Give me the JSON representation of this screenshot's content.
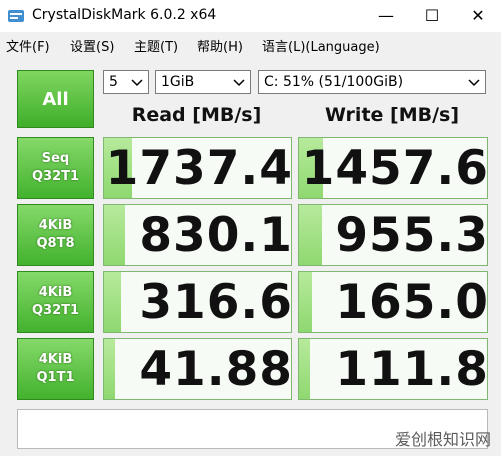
{
  "window": {
    "title": "CrystalDiskMark 6.0.2 x64",
    "minimize": "—",
    "maximize": "☐",
    "close": "✕"
  },
  "menu": [
    "文件(F)",
    "设置(S)",
    "主题(T)",
    "帮助(H)",
    "语言(L)(Language)"
  ],
  "controls": {
    "all_label": "All",
    "count": "5",
    "size": "1GiB",
    "drive": "C: 51% (51/100GiB)"
  },
  "headers": {
    "read": "Read [MB/s]",
    "write": "Write [MB/s]"
  },
  "rows": [
    {
      "label1": "Seq",
      "label2": "Q32T1",
      "read": "1737.4",
      "write": "1457.6",
      "read_fill": 0.15,
      "write_fill": 0.13
    },
    {
      "label1": "4KiB",
      "label2": "Q8T8",
      "read": "830.1",
      "write": "955.3",
      "read_fill": 0.11,
      "write_fill": 0.12
    },
    {
      "label1": "4KiB",
      "label2": "Q32T1",
      "read": "316.6",
      "write": "165.0",
      "read_fill": 0.09,
      "write_fill": 0.07
    },
    {
      "label1": "4KiB",
      "label2": "Q1T1",
      "read": "41.88",
      "write": "111.8",
      "read_fill": 0.06,
      "write_fill": 0.06
    }
  ],
  "comment": "",
  "watermark": "爱创根知识网",
  "colors": {
    "accent_green": "#43b22e",
    "bar_green": "#8fd870"
  }
}
